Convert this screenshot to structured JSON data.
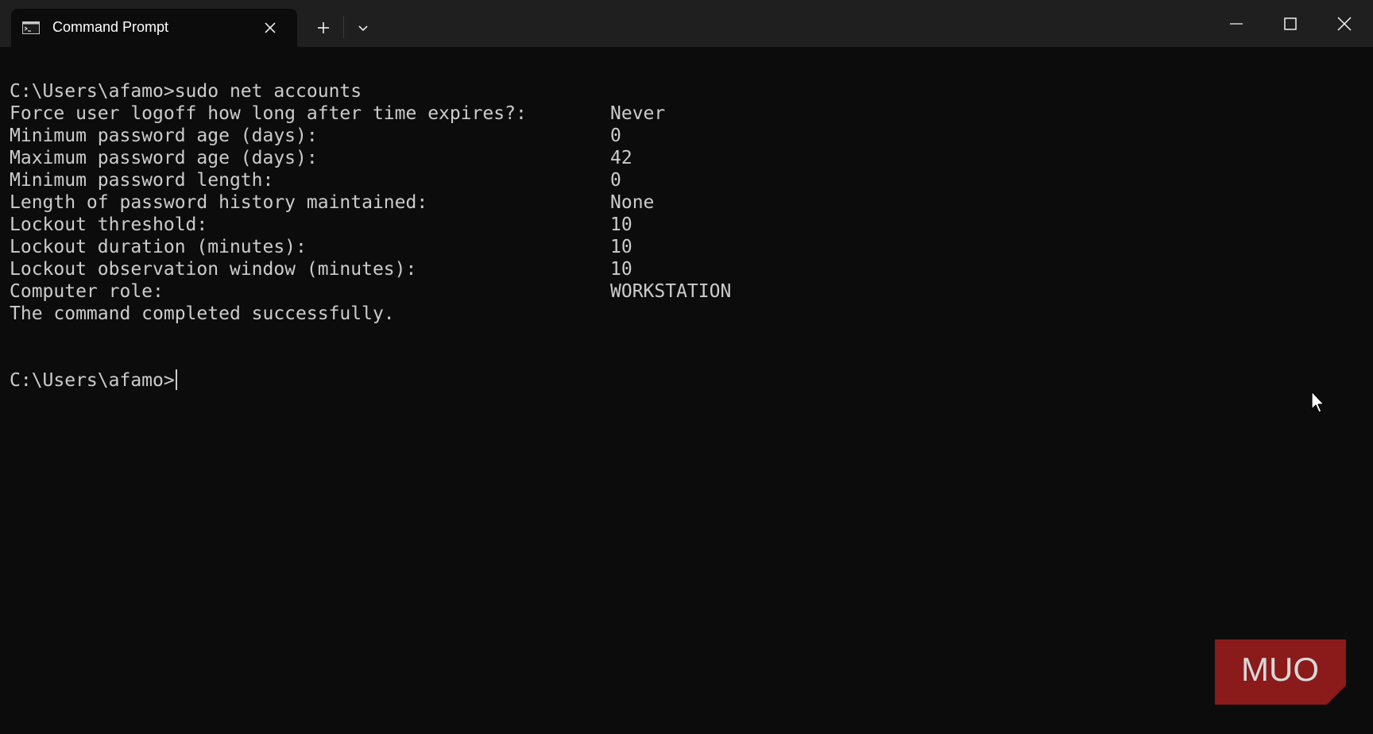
{
  "window": {
    "tab_title": "Command Prompt",
    "tab_icon": "terminal-icon",
    "buttons": {
      "close_tab": "close-icon",
      "new_tab": "plus-icon",
      "dropdown": "chevron-down-icon",
      "minimize": "minimize-icon",
      "maximize": "maximize-icon",
      "close_window": "close-icon"
    }
  },
  "terminal": {
    "command_line": "C:\\Users\\afamo>sudo net accounts",
    "settings": [
      {
        "label": "Force user logoff how long after time expires?:",
        "value": "Never"
      },
      {
        "label": "Minimum password age (days):",
        "value": "0"
      },
      {
        "label": "Maximum password age (days):",
        "value": "42"
      },
      {
        "label": "Minimum password length:",
        "value": "0"
      },
      {
        "label": "Length of password history maintained:",
        "value": "None"
      },
      {
        "label": "Lockout threshold:",
        "value": "10"
      },
      {
        "label": "Lockout duration (minutes):",
        "value": "10"
      },
      {
        "label": "Lockout observation window (minutes):",
        "value": "10"
      },
      {
        "label": "Computer role:",
        "value": "WORKSTATION"
      }
    ],
    "status": "The command completed successfully.",
    "prompt": "C:\\Users\\afamo>"
  },
  "watermark": {
    "text": "MUO"
  },
  "colors": {
    "background": "#0c0c0c",
    "titlebar": "#1f1f1f",
    "text": "#cccccc",
    "watermark": "#8b1a1a"
  }
}
